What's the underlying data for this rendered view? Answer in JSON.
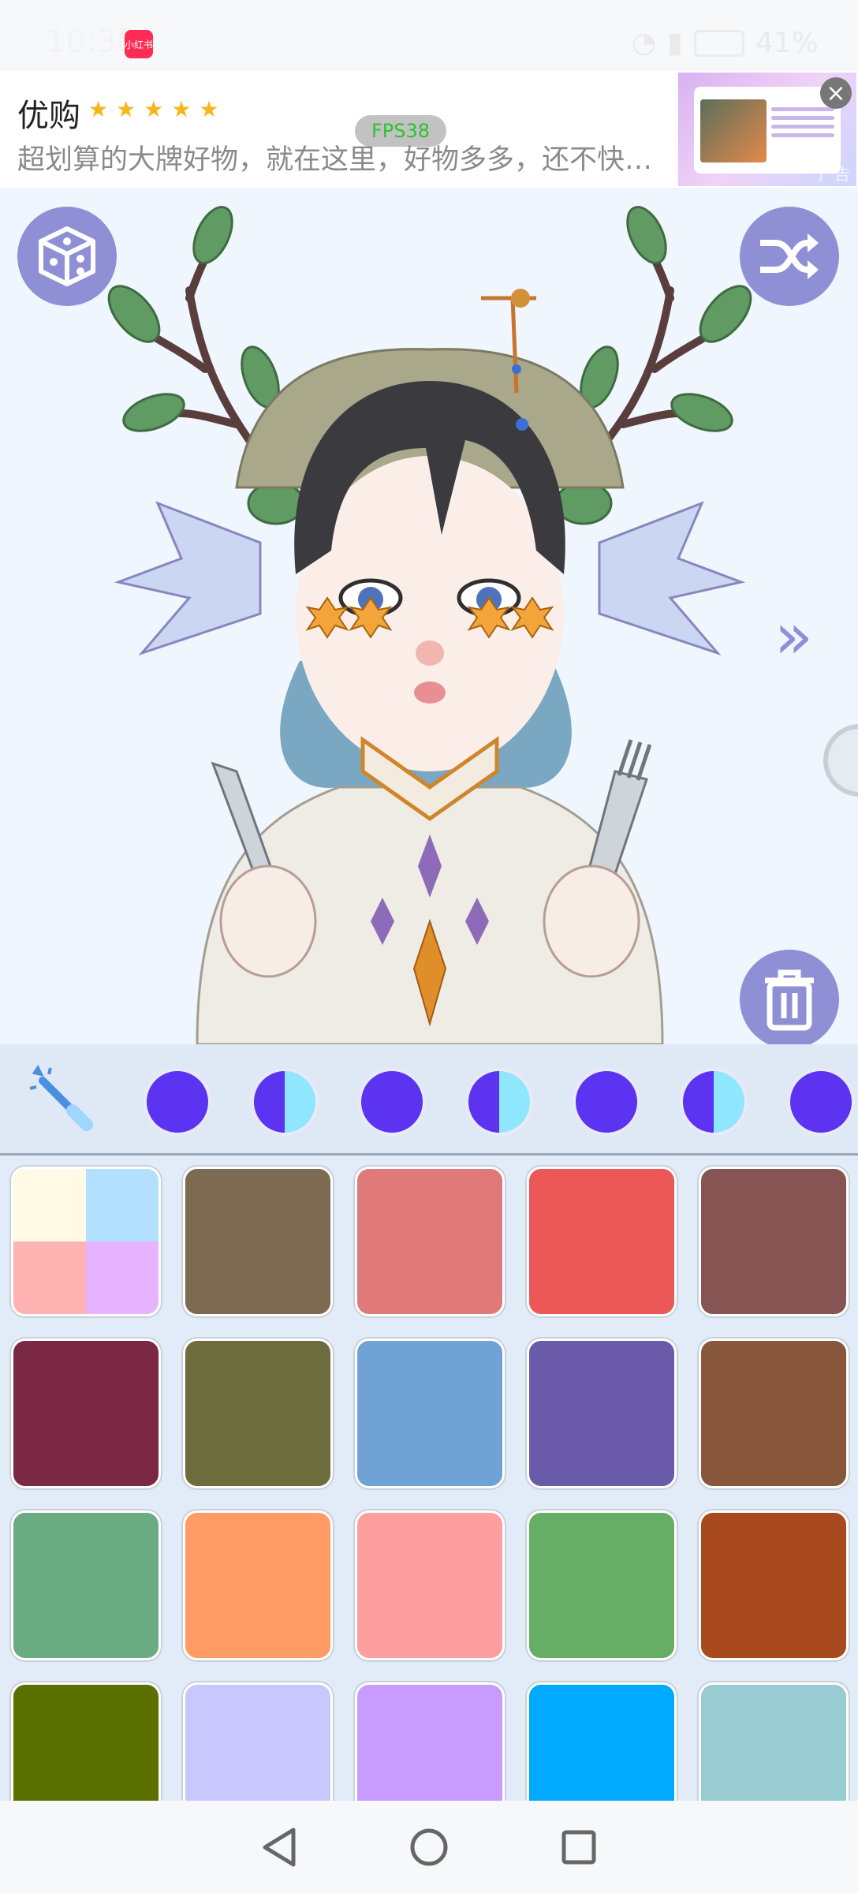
{
  "status_bar": {
    "time": "10:38",
    "app_badge": "小红书",
    "battery": "41%"
  },
  "ad": {
    "title": "优购",
    "stars": [
      "★",
      "★",
      "★",
      "★",
      "★"
    ],
    "description": "超划算的大牌好物，就在这里，好物多多，还不快…",
    "fps_label": "FPS38",
    "label": "广告",
    "close_symbol": "×"
  },
  "canvas": {
    "next_label": "»"
  },
  "toolbar": {
    "items": [
      {
        "name": "magic-wand-tool",
        "kind": "wand"
      },
      {
        "name": "face-tool-1",
        "kind": "face"
      },
      {
        "name": "face-tool-2",
        "kind": "half"
      },
      {
        "name": "face-tool-3",
        "kind": "face"
      },
      {
        "name": "face-tool-4",
        "kind": "half"
      },
      {
        "name": "face-tool-5",
        "kind": "face"
      },
      {
        "name": "face-tool-6",
        "kind": "half"
      },
      {
        "name": "face-tool-7",
        "kind": "face"
      }
    ]
  },
  "palette": {
    "colors": [
      [
        "multi",
        "#7d6b51",
        "#e07a7a",
        "#ec5757",
        "#875454"
      ],
      [
        "#7b2845",
        "#6c6c3d",
        "#70a2d6",
        "#6a5aaa",
        "#87563b"
      ],
      [
        "#6aab82",
        "#ff9c66",
        "#ff9e9e",
        "#66ad66",
        "#a84a1e"
      ],
      [
        "#5c7000",
        "#c8c8ff",
        "#c89cff",
        "#00aaff",
        "#99ccd2"
      ]
    ],
    "multi_colors": [
      "#fff9e6",
      "#b3e0ff",
      "#ffb3b3",
      "#e6b3ff"
    ]
  },
  "colors": {
    "accent_purple": "#8f8fd6",
    "toolbar_face": "#5c33f0"
  },
  "icons": {
    "dice": "dice-icon",
    "shuffle": "shuffle-icon",
    "trash": "trash-icon",
    "back": "back-triangle-icon",
    "home": "home-circle-icon",
    "recent": "recent-square-icon"
  }
}
